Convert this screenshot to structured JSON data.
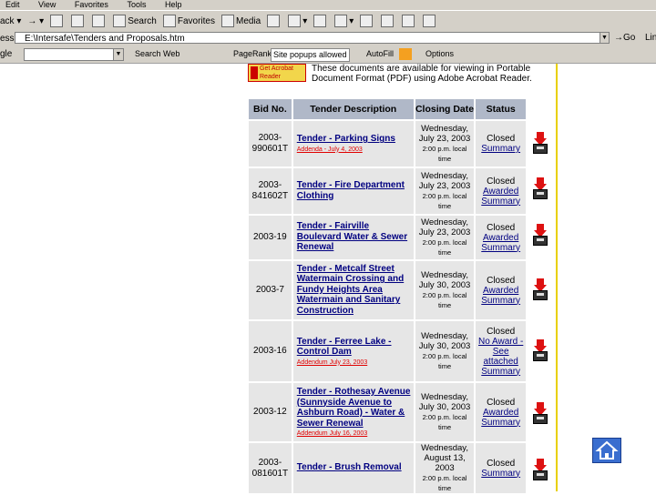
{
  "menu": [
    "Edit",
    "View",
    "Favorites",
    "Tools",
    "Help"
  ],
  "toolbar": {
    "back": "ack",
    "search": "Search",
    "favorites": "Favorites",
    "media": "Media"
  },
  "address": {
    "label": "ess",
    "value": "E:\\Intersafe\\Tenders and Proposals.htm",
    "go": "Go",
    "links": "Lin"
  },
  "googlebar": {
    "label": "gle",
    "search_web": "Search Web",
    "pagerank": "PageRank",
    "popups": "Site popups allowed",
    "autofill": "AutoFill",
    "options": "Options"
  },
  "acrobat": {
    "line1": "Get Acrobat",
    "line2": "Reader"
  },
  "intro": "These documents are available for viewing in Portable Document Format (PDF) using Adobe Acrobat Reader.",
  "table": {
    "headers": [
      "Bid No.",
      "Tender Description",
      "Closing Date",
      "Status"
    ],
    "rows": [
      {
        "bid": "2003-990601T",
        "desc": "Tender - Parking Signs",
        "note": "Addenda - July 4, 2003",
        "date": "Wednesday, July 23, 2003",
        "time": "2:00 p.m. local time",
        "status": "Closed",
        "status_link": "Summary"
      },
      {
        "bid": "2003-841602T",
        "desc": "Tender - Fire Department Clothing",
        "note": "",
        "date": "Wednesday, July 23, 2003",
        "time": "2:00 p.m. local time",
        "status": "Closed",
        "status_link": "Awarded Summary"
      },
      {
        "bid": "2003-19",
        "desc": "Tender - Fairville Boulevard Water & Sewer Renewal",
        "note": "",
        "date": "Wednesday, July 23, 2003",
        "time": "2:00 p.m. local time",
        "status": "Closed",
        "status_link": "Awarded Summary"
      },
      {
        "bid": "2003-7",
        "desc": "Tender - Metcalf Street Watermain Crossing and Fundy Heights Area Watermain and Sanitary Construction",
        "note": "",
        "date": "Wednesday, July 30, 2003",
        "time": "2:00 p.m. local time",
        "status": "Closed",
        "status_link": "Awarded Summary"
      },
      {
        "bid": "2003-16",
        "desc": "Tender - Ferree Lake - Control Dam",
        "note": "Addendum July 23, 2003",
        "date": "Wednesday, July 30, 2003",
        "time": "2:00 p.m. local time",
        "status": "Closed",
        "status_link": "No Award - See attached Summary"
      },
      {
        "bid": "2003-12",
        "desc": "Tender - Rothesay Avenue (Sunnyside Avenue to Ashburn Road) - Water & Sewer Renewal",
        "note": "Addendum July 16, 2003",
        "date": "Wednesday, July 30, 2003",
        "time": "2:00 p.m. local time",
        "status": "Closed",
        "status_link": "Awarded Summary"
      },
      {
        "bid": "2003-081601T",
        "desc": "Tender - Brush Removal",
        "note": "",
        "date": "Wednesday, August 13, 2003",
        "time": "2:00 p.m. local time",
        "status": "Closed",
        "status_link": "Summary"
      }
    ]
  },
  "colors": {
    "header_bg": "#b0b8c8",
    "row_bg": "#e6e6e6",
    "addendum": "#e00000",
    "divider": "#e8d000"
  },
  "icons": [
    "pdf-download-icon",
    "home-icon"
  ]
}
